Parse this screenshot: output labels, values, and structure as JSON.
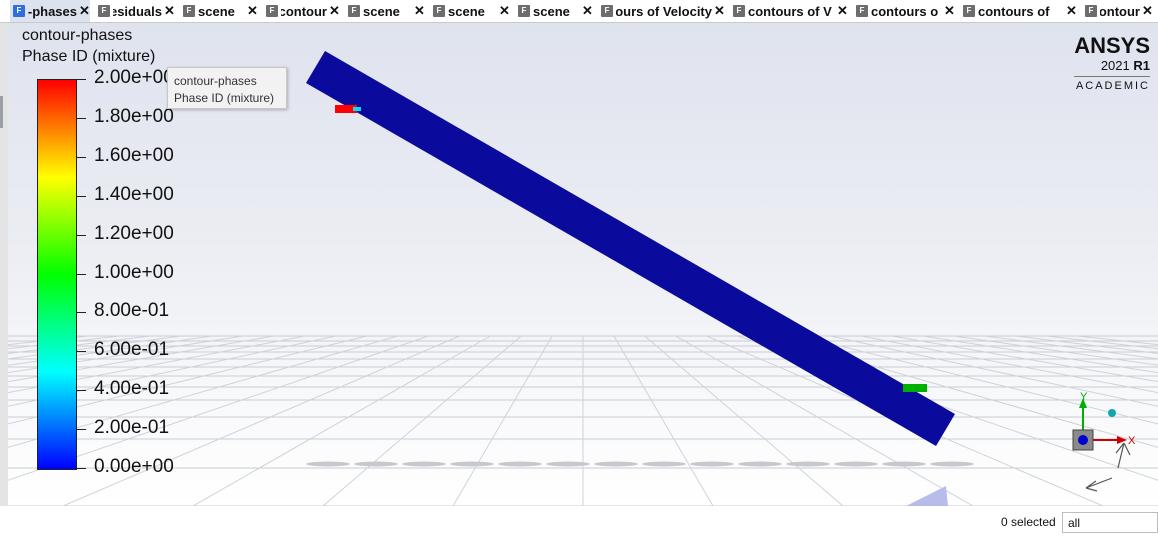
{
  "tabs": [
    {
      "label": "contour-phases",
      "active": true
    },
    {
      "label": "Scaled Residuals",
      "active": false
    },
    {
      "label": "scene",
      "active": false
    },
    {
      "label": "contour",
      "active": false
    },
    {
      "label": "scene",
      "active": false
    },
    {
      "label": "scene",
      "active": false
    },
    {
      "label": "scene",
      "active": false
    },
    {
      "label": "contours of Velocity",
      "active": false
    },
    {
      "label": "contours of V",
      "active": false
    },
    {
      "label": "contours o",
      "active": false
    },
    {
      "label": "contours of",
      "active": false
    },
    {
      "label": "contour",
      "active": false
    }
  ],
  "tab_close_glyph": "✕",
  "tab_file_glyph": "F",
  "colorbar": {
    "title_line1": "contour-phases",
    "title_line2": "Phase ID (mixture)",
    "ticks": [
      "2.00e+00",
      "1.80e+00",
      "1.60e+00",
      "1.40e+00",
      "1.20e+00",
      "1.00e+00",
      "8.00e-01",
      "6.00e-01",
      "4.00e-01",
      "2.00e-01",
      "0.00e+00"
    ],
    "range": [
      0,
      2
    ],
    "colormap": [
      "#0000ff",
      "#00ffff",
      "#00ff00",
      "#ffff00",
      "#ff0000"
    ]
  },
  "tooltip": {
    "line1": "contour-phases",
    "line2": "Phase ID (mixture)"
  },
  "brand": {
    "name": "ANSYS",
    "version": "2021",
    "release": "R1",
    "edition": "ACADEMIC"
  },
  "axes": {
    "x_label": "X",
    "y_label": "Y"
  },
  "status": {
    "selected_text": "0 selected",
    "filter_value": "all"
  },
  "colors": {
    "geometry": "#0a0a9c",
    "accent_red": "#ff0000",
    "accent_green": "#00b000",
    "axis_x": "#d00000",
    "axis_y": "#00b000",
    "axis_z": "#0000d0"
  },
  "icons": {
    "rotate_icon": "rotate-arrows-icon",
    "file_icon": "fluent-file-icon",
    "close_icon": "close-icon"
  }
}
